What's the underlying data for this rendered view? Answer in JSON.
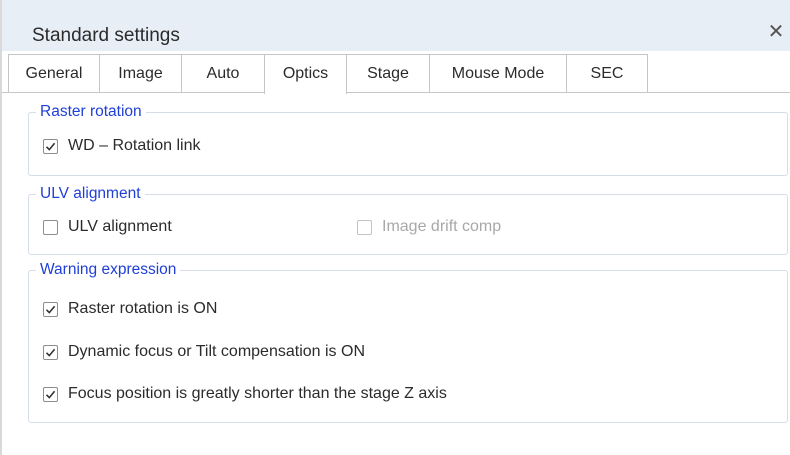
{
  "window": {
    "title": "Standard settings",
    "close_symbol": "✕"
  },
  "tabs": [
    {
      "label": "General",
      "active": false
    },
    {
      "label": "Image",
      "active": false
    },
    {
      "label": "Auto",
      "active": false
    },
    {
      "label": "Optics",
      "active": true
    },
    {
      "label": "Stage",
      "active": false
    },
    {
      "label": "Mouse Mode",
      "active": false
    },
    {
      "label": "SEC",
      "active": false
    }
  ],
  "groups": {
    "raster_rotation": {
      "title": "Raster rotation",
      "items": [
        {
          "label": "WD – Rotation link",
          "checked": true,
          "enabled": true
        }
      ]
    },
    "ulv_alignment": {
      "title": "ULV alignment",
      "items": [
        {
          "label": "ULV alignment",
          "checked": false,
          "enabled": true
        },
        {
          "label": "Image drift comp",
          "checked": false,
          "enabled": false
        }
      ]
    },
    "warning_expression": {
      "title": "Warning expression",
      "items": [
        {
          "label": "Raster rotation is ON",
          "checked": true,
          "enabled": true
        },
        {
          "label": "Dynamic focus or Tilt compensation is ON",
          "checked": true,
          "enabled": true
        },
        {
          "label": "Focus position is greatly shorter than the stage Z axis",
          "checked": true,
          "enabled": true
        }
      ]
    }
  },
  "colors": {
    "titlebar_bg": "#e7eef6",
    "group_title": "#1f3fd6",
    "disabled_text": "#a8a8a8"
  },
  "icons": {
    "close": "close-icon",
    "check": "checkmark-icon"
  }
}
